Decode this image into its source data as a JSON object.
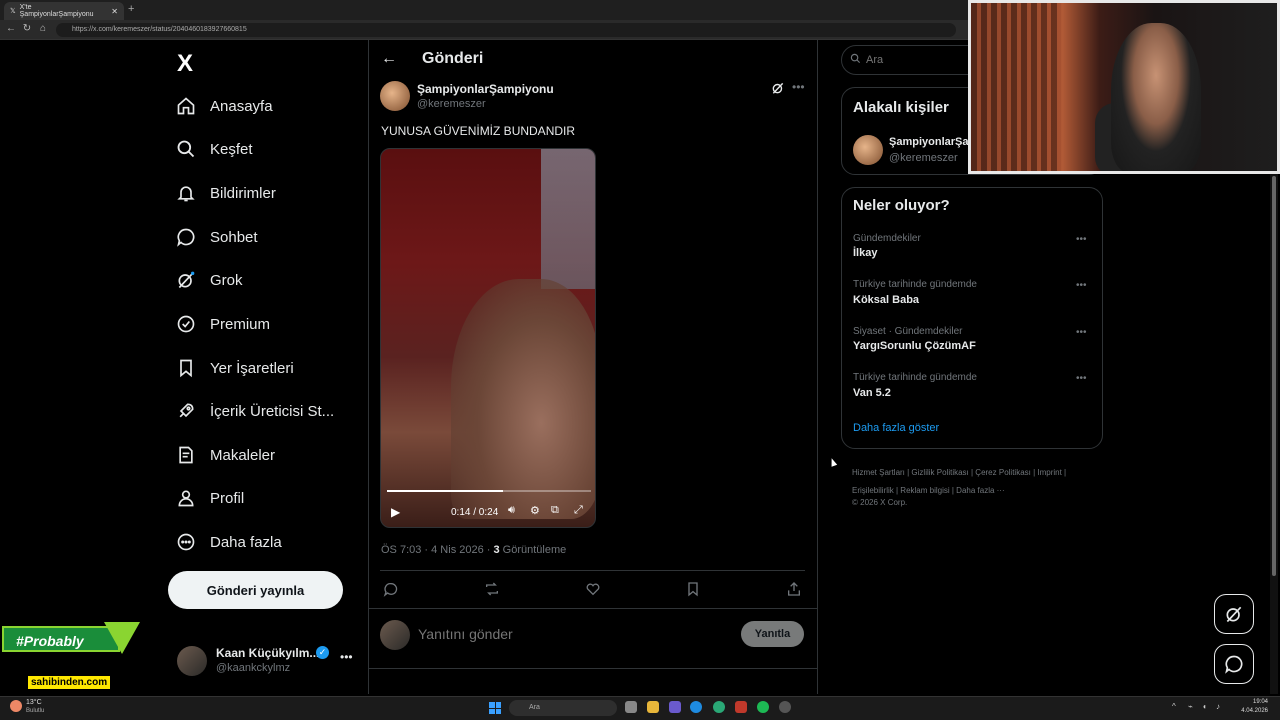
{
  "browser": {
    "tab_title": "X'te ŞampiyonlarŞampiyonu",
    "url": "https://x.com/keremeszer/status/2040460183927660815"
  },
  "nav": {
    "logo": "X",
    "items": [
      {
        "label": "Anasayfa",
        "icon": "home-icon"
      },
      {
        "label": "Keşfet",
        "icon": "search-icon"
      },
      {
        "label": "Bildirimler",
        "icon": "bell-icon"
      },
      {
        "label": "Sohbet",
        "icon": "chat-icon"
      },
      {
        "label": "Grok",
        "icon": "grok-icon"
      },
      {
        "label": "Premium",
        "icon": "premium-icon"
      },
      {
        "label": "Yer İşaretleri",
        "icon": "bookmark-icon"
      },
      {
        "label": "İçerik Üreticisi St...",
        "icon": "rocket-icon"
      },
      {
        "label": "Makaleler",
        "icon": "article-icon"
      },
      {
        "label": "Profil",
        "icon": "profile-icon"
      },
      {
        "label": "Daha fazla",
        "icon": "more-circle-icon"
      }
    ],
    "post_button": "Gönderi yayınla",
    "account": {
      "name": "Kaan Küçükyılm...",
      "handle": "@kaankckylmz"
    }
  },
  "overlay": {
    "sponsor": "#Probably",
    "sahibinden": "sahibinden.com"
  },
  "post": {
    "page_title": "Gönderi",
    "author_name": "ŞampiyonlarŞampiyonu",
    "author_handle": "@keremeszer",
    "text": "YUNUSA GÜVENİMİZ BUNDANDIR",
    "video": {
      "time": "0:14 / 0:24",
      "progress": 0.57
    },
    "meta_time": "ÖS 7:03 · 4 Nis 2026 · ",
    "views_count": "3",
    "views_label": " Görüntüleme",
    "reply_placeholder": "Yanıtını gönder",
    "reply_button": "Yanıtla"
  },
  "right": {
    "search_placeholder": "Ara",
    "relevant_title": "Alakalı kişiler",
    "relevant_name": "ŞampiyonlarŞa",
    "relevant_handle": "@keremeszer",
    "trends_title": "Neler oluyor?",
    "trends": [
      {
        "category": "Gündemdekiler",
        "name": "İlkay"
      },
      {
        "category": "Türkiye tarihinde gündemde",
        "name": "Köksal Baba"
      },
      {
        "category": "Siyaset · Gündemdekiler",
        "name": "YargıSorunlu ÇözümAF"
      },
      {
        "category": "Türkiye tarihinde gündemde",
        "name": "Van 5.2"
      }
    ],
    "show_more": "Daha fazla göster",
    "footer_links": "Hizmet Şartları  |  Gizlilik Politikası  |  Çerez Politikası  |  Imprint  |  Erişilebilirlik  |  Reklam bilgisi  |  Daha fazla ···",
    "copyright": "© 2026 X Corp."
  },
  "taskbar": {
    "weather_temp": "13°C",
    "weather_desc": "Bulutlu",
    "search": "Ara",
    "time": "19:04",
    "date": "4.04.2026"
  },
  "colors": {
    "accent": "#1d9bf0",
    "background": "#000000",
    "text": "#e7e9ea",
    "muted": "#71767b"
  }
}
